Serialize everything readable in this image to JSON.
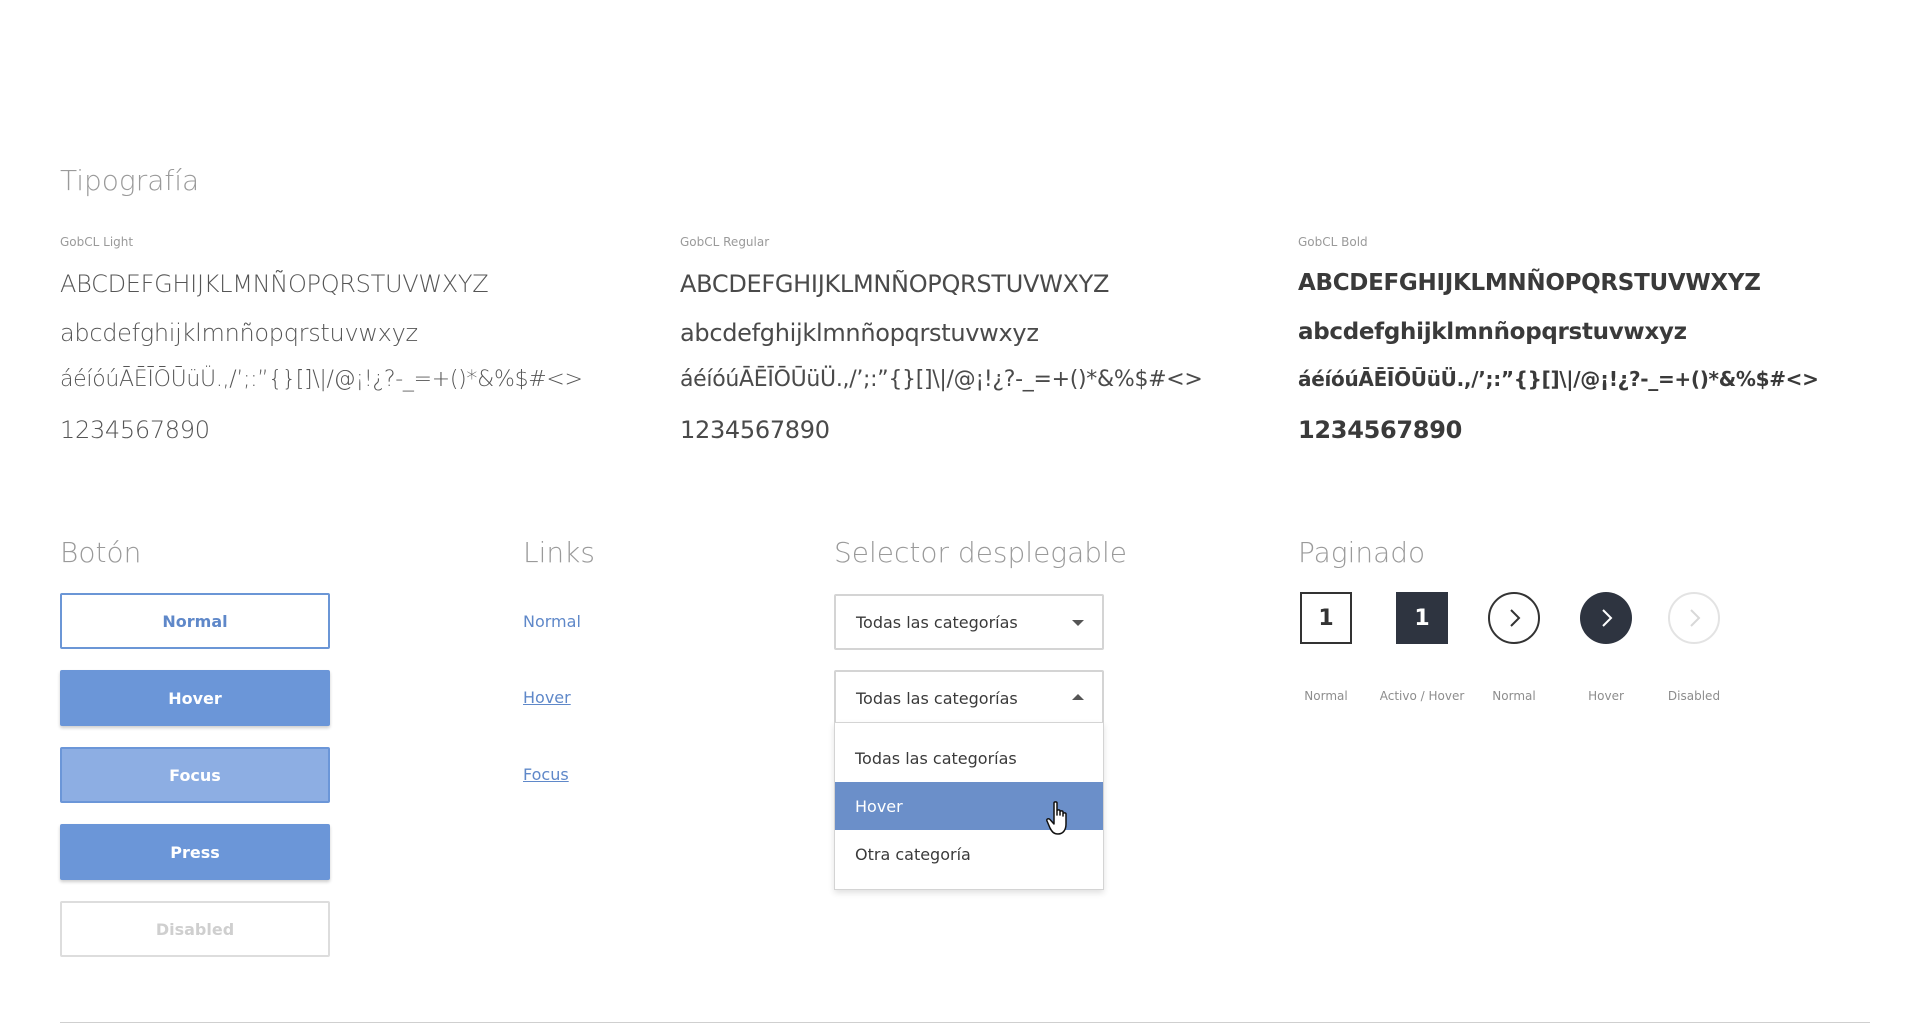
{
  "typography": {
    "title": "Tipografía",
    "columns": [
      {
        "font_name": "GobCL Light",
        "uppercase": "ABCDEFGHIJKLMNÑOPQRSTUVWXYZ",
        "lowercase": "abcdefghijklmnñopqrstuvwxyz",
        "symbols": "áéíóúĀĒĪŌŪüÜ.,/’;:”{}[]\\|/@¡!¿?-_=+()*&%$#<>",
        "digits": "1234567890"
      },
      {
        "font_name": "GobCL Regular",
        "uppercase": "ABCDEFGHIJKLMNÑOPQRSTUVWXYZ",
        "lowercase": "abcdefghijklmnñopqrstuvwxyz",
        "symbols": "áéíóúĀĒĪŌŪüÜ.,/’;:”{}[]\\|/@¡!¿?-_=+()*&%$#<>",
        "digits": "1234567890"
      },
      {
        "font_name": "GobCL Bold",
        "uppercase": "ABCDEFGHIJKLMNÑOPQRSTUVWXYZ",
        "lowercase": "abcdefghijklmnñopqrstuvwxyz",
        "symbols": "áéíóúĀĒĪŌŪüÜ.,/’;:”{}[]\\|/@¡!¿?-_=+()*&%$#<>",
        "digits": "1234567890"
      }
    ]
  },
  "buttons": {
    "title": "Botón",
    "normal": "Normal",
    "hover": "Hover",
    "focus": "Focus",
    "press": "Press",
    "disabled": "Disabled"
  },
  "links": {
    "title": "Links",
    "normal": "Normal",
    "hover": "Hover",
    "focus": "Focus"
  },
  "selector": {
    "title": "Selector desplegable",
    "closed_value": "Todas las categorías",
    "open_value": "Todas las categorías",
    "options": [
      "Todas las categorías",
      "Hover",
      "Otra categoría"
    ],
    "highlighted_option": "Hover"
  },
  "pagination": {
    "title": "Paginado",
    "page_number": "1",
    "active_page_number": "1",
    "labels": {
      "square_normal": "Normal",
      "square_active": "Activo / Hover",
      "circle_normal": "Normal",
      "circle_hover": "Hover",
      "circle_disabled": "Disabled"
    }
  },
  "colors": {
    "primary": "#6b96d8",
    "primary_light": "#8daee3",
    "link": "#5f88c9",
    "dark": "#2e3440",
    "dropdown_highlight": "#6b8fc9",
    "muted_text": "#9a9a9a"
  }
}
